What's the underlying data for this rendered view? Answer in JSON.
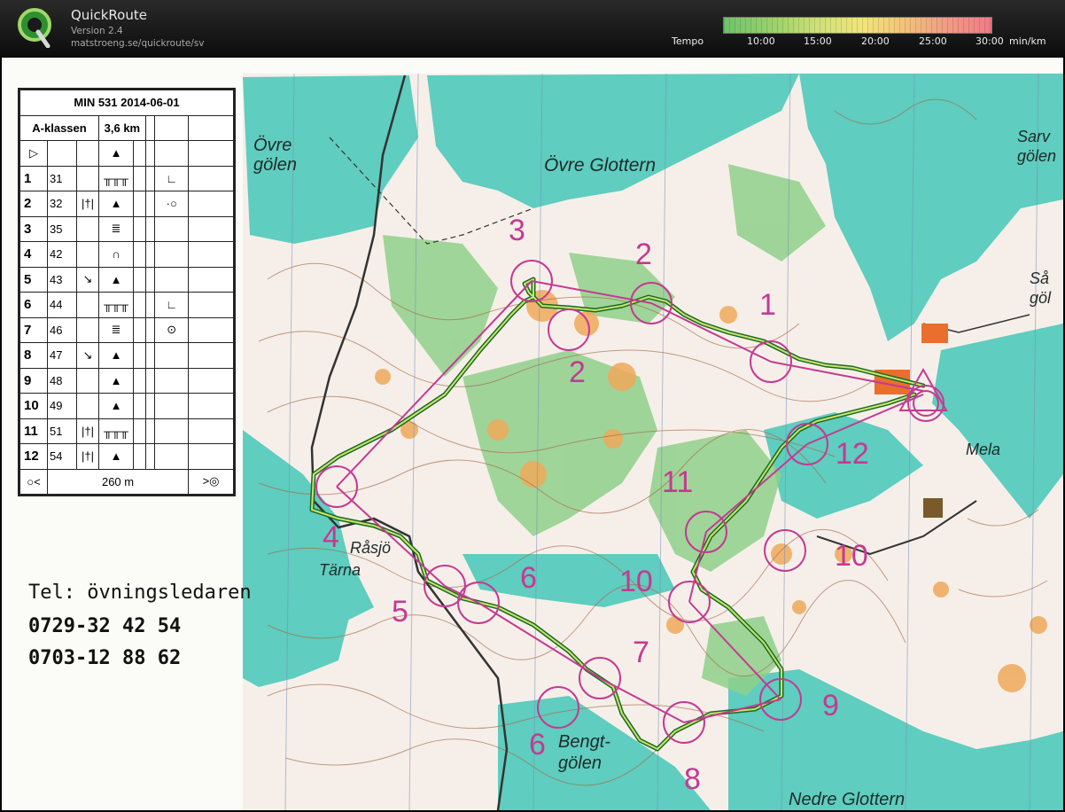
{
  "app": {
    "title": "QuickRoute",
    "version": "Version 2.4",
    "url": "matstroeng.se/quickroute/sv"
  },
  "tempo": {
    "label": "Tempo",
    "ticks": [
      "10:00",
      "15:00",
      "20:00",
      "25:00",
      "30:00"
    ],
    "unit": "min/km"
  },
  "description_sheet": {
    "event": "MIN 531 2014-06-01",
    "class": "A-klassen",
    "length": "3,6 km",
    "controls": [
      {
        "n": "1",
        "code": "31"
      },
      {
        "n": "2",
        "code": "32"
      },
      {
        "n": "3",
        "code": "35"
      },
      {
        "n": "4",
        "code": "42"
      },
      {
        "n": "5",
        "code": "43"
      },
      {
        "n": "6",
        "code": "44"
      },
      {
        "n": "7",
        "code": "46"
      },
      {
        "n": "8",
        "code": "47"
      },
      {
        "n": "9",
        "code": "48"
      },
      {
        "n": "10",
        "code": "49"
      },
      {
        "n": "11",
        "code": "51"
      },
      {
        "n": "12",
        "code": "54"
      }
    ],
    "finish_distance": "260 m"
  },
  "contact": {
    "label": "Tel: övningsledaren",
    "phone1": "0729-32 42 54",
    "phone2": "0703-12 88 62"
  },
  "map_labels": {
    "ovre_golen": "Övre gölen",
    "ovre_glottern": "Övre Glottern",
    "sarv_golen": "Sarv gölen",
    "sa_gol": "Så göl",
    "mela": "Mela",
    "rasjo": "Råsjö",
    "tarna": "Tärna",
    "bengt_golen": "Bengt- gölen",
    "nedre_glottern": "Nedre Glottern"
  },
  "control_numbers": [
    "1",
    "2",
    "2",
    "3",
    "4",
    "5",
    "6",
    "6",
    "7",
    "8",
    "9",
    "10",
    "10",
    "11",
    "12"
  ],
  "colors": {
    "water": "#5fcdbf",
    "green": "#8fd08a",
    "control": "#c43a93",
    "route": "#3bb24a"
  }
}
